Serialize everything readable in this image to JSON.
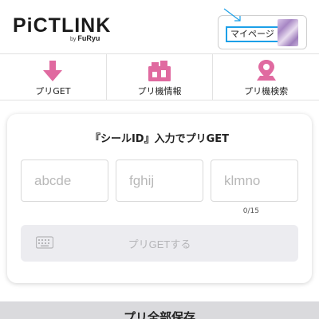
{
  "header": {
    "logo_text": "PiCTLINK",
    "logo_by": "by",
    "logo_brand": "FuRyu",
    "mypage_label": "マイページ"
  },
  "nav": {
    "items": [
      {
        "label": "プリGET",
        "icon": "download-arrow-icon"
      },
      {
        "label": "プリ機情報",
        "icon": "photo-booth-icon"
      },
      {
        "label": "プリ機検索",
        "icon": "map-pin-icon"
      }
    ]
  },
  "card": {
    "title": "『シールID』入力でプリGET",
    "inputs": [
      {
        "placeholder": "abcde",
        "value": ""
      },
      {
        "placeholder": "fghij",
        "value": ""
      },
      {
        "placeholder": "klmno",
        "value": ""
      }
    ],
    "counter": "0/15",
    "submit_label": "プリGETする"
  },
  "bottom": {
    "save_all_label": "プリ全部保存"
  },
  "colors": {
    "accent_pink": "#e06aa0",
    "pointer_blue": "#1ca0e8",
    "button_disabled_bg": "#ececf0"
  }
}
